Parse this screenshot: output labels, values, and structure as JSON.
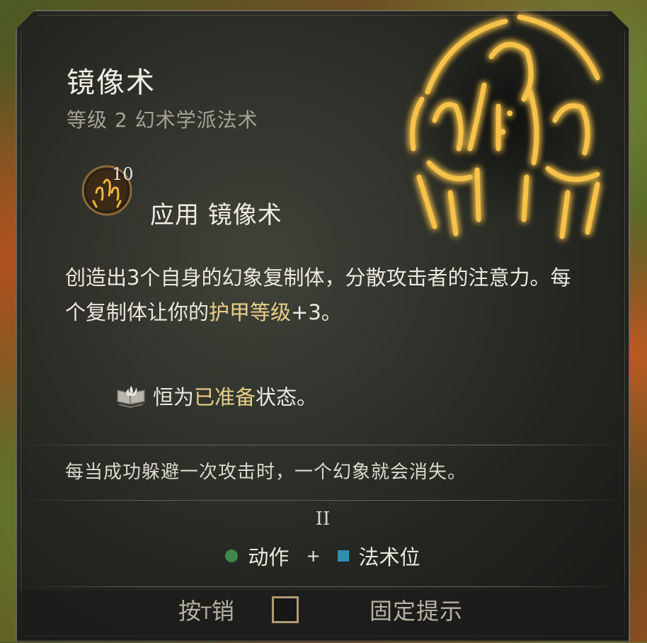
{
  "spell": {
    "name": "镜像术",
    "subtitle": "等级 2 幻术学派法术",
    "art_icon": "mirror-image-spell-icon"
  },
  "apply": {
    "count": "10",
    "label": "应用 镜像术",
    "icon": "mirror-image-small-icon"
  },
  "description": {
    "part1": "创造出3个自身的幻象复制体，分散攻击者的注意力。每个复制体让你的",
    "highlight": "护甲等级",
    "part2": "+3。"
  },
  "ready": {
    "icon": "spellbook-icon",
    "prefix": "恒为",
    "highlight": "已准备",
    "suffix": "状态。"
  },
  "note": "每当成功躲避一次攻击时，一个幻象就会消失。",
  "cost": {
    "level_numeral": "II",
    "action_label": "动作",
    "plus": "+",
    "slot_label": "法术位",
    "action_color": "#3e8a4a",
    "slot_color": "#2f8fb0"
  },
  "footer": {
    "hint_prefix": "按",
    "hint_key": "T",
    "hint_suffix": "销",
    "pin_label": "固定提示"
  },
  "colors": {
    "highlight": "#e8d08a",
    "glow": "#f5b83a"
  }
}
